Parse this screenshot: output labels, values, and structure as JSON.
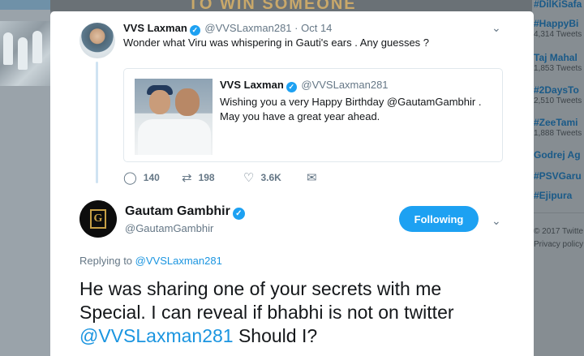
{
  "background": {
    "banner_text": "TO WIN SOMEONE",
    "trends": [
      {
        "tag": "#DilKiSafa",
        "count": ""
      },
      {
        "tag": "#HappyBi",
        "count": "4,314 Tweets"
      },
      {
        "tag": "Taj Mahal",
        "count": "1,853 Tweets"
      },
      {
        "tag": "#2DaysTo",
        "count": "2,510 Tweets"
      },
      {
        "tag": "#ZeeTami",
        "count": "1,888 Tweets"
      },
      {
        "tag": "Godrej Ag",
        "count": ""
      },
      {
        "tag": "#PSVGaru",
        "count": ""
      },
      {
        "tag": "#Ejipura",
        "count": ""
      }
    ],
    "footer": {
      "copyright": "© 2017 Twitte",
      "privacy": "Privacy policy"
    }
  },
  "parent_tweet": {
    "name": "VVS Laxman",
    "handle": "@VVSLaxman281",
    "date": "· Oct 14",
    "text": "Wonder what Viru was whispering in Gauti's ears . Any guesses ?",
    "quoted": {
      "name": "VVS Laxman",
      "handle": "@VVSLaxman281",
      "line1": "Wishing you a very Happy Birthday @GautamGambhir .",
      "line2": "May  you have a great year ahead."
    },
    "stats": {
      "replies": "140",
      "retweets": "198",
      "likes": "3.6K"
    }
  },
  "reply_tweet": {
    "name": "Gautam Gambhir",
    "handle": "@GautamGambhir",
    "follow_label": "Following",
    "replying_prefix": "Replying to",
    "replying_to": "@VVSLaxman281",
    "text_line1": "He was sharing one of your secrets with me",
    "text_line2": "Special. I can reveal if bhabhi is not on twitter",
    "text_mention": "@VVSLaxman281",
    "text_tail": "Should I?"
  },
  "icons": {
    "verified": "✓",
    "chevron": "⌄",
    "reply": "◯",
    "retweet": "⇄",
    "like": "♡",
    "dm": "✉"
  },
  "colors": {
    "accent": "#1da1f2",
    "link": "#1b95e0",
    "text": "#14171a",
    "muted": "#657786"
  }
}
